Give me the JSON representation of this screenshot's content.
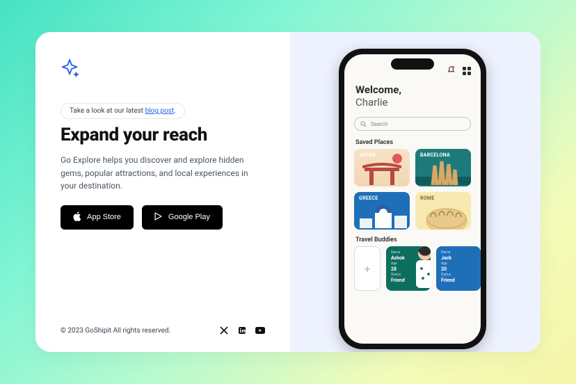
{
  "announce": {
    "prefix": "Take a look at our latest ",
    "link_text": "blog post",
    "suffix": "."
  },
  "headline": "Expand your reach",
  "description": "Go Explore helps you discover and explore hidden gems, popular attractions, and local experiences in your destination.",
  "buttons": {
    "appstore": "App Store",
    "googleplay": "Google Play"
  },
  "footer": {
    "copyright": "© 2023 GoShipit All rights reserved."
  },
  "phone": {
    "welcome_label": "Welcome,",
    "user_name": "Charlie",
    "search_placeholder": "Search",
    "saved_section": "Saved Places",
    "buddies_section": "Travel Buddies",
    "places": [
      {
        "label": "JAPAN",
        "bg": "#f2d6b3"
      },
      {
        "label": "BARCELONA",
        "bg": "#1e7a7a"
      },
      {
        "label": "GREECE",
        "bg": "#1e6fb8"
      },
      {
        "label": "ROME",
        "bg": "#f8e9b0"
      }
    ],
    "buddies": [
      {
        "name": "Ashok",
        "age": "28",
        "status": "Friend",
        "bg": "#0d6d5e"
      },
      {
        "name": "Jack",
        "age": "20",
        "status": "Friend",
        "bg": "#1e6fb8"
      }
    ],
    "labels": {
      "name": "Name",
      "age": "Age",
      "status": "Status"
    }
  }
}
